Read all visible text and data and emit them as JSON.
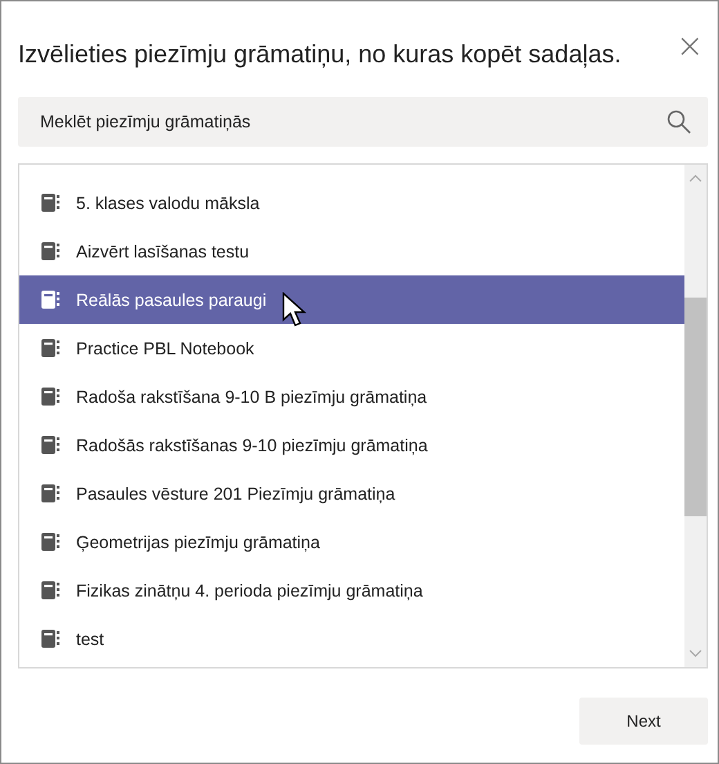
{
  "dialog": {
    "title": "Izvēlieties piezīmju grāmatiņu, no kuras kopēt sadaļas.",
    "close_glyph": "×"
  },
  "search": {
    "placeholder": "Meklēt piezīmju grāmatiņās"
  },
  "notebooks": [
    {
      "name": "5. klases valodu māksla",
      "selected": false
    },
    {
      "name": "Aizvērt lasīšanas testu",
      "selected": false
    },
    {
      "name": "Reālās pasaules paraugi",
      "selected": true
    },
    {
      "name": "Practice PBL Notebook",
      "selected": false
    },
    {
      "name": "Radoša rakstīšana 9-10 B piezīmju grāmatiņa",
      "selected": false
    },
    {
      "name": "Radošās rakstīšanas 9-10 piezīmju grāmatiņa",
      "selected": false
    },
    {
      "name": "Pasaules vēsture 201  Piezīmju grāmatiņa",
      "selected": false
    },
    {
      "name": "Ģeometrijas piezīmju grāmatiņa",
      "selected": false
    },
    {
      "name": "Fizikas zinātņu 4. perioda piezīmju grāmatiņa",
      "selected": false
    },
    {
      "name": "test",
      "selected": false
    }
  ],
  "buttons": [
    "Next"
  ]
}
